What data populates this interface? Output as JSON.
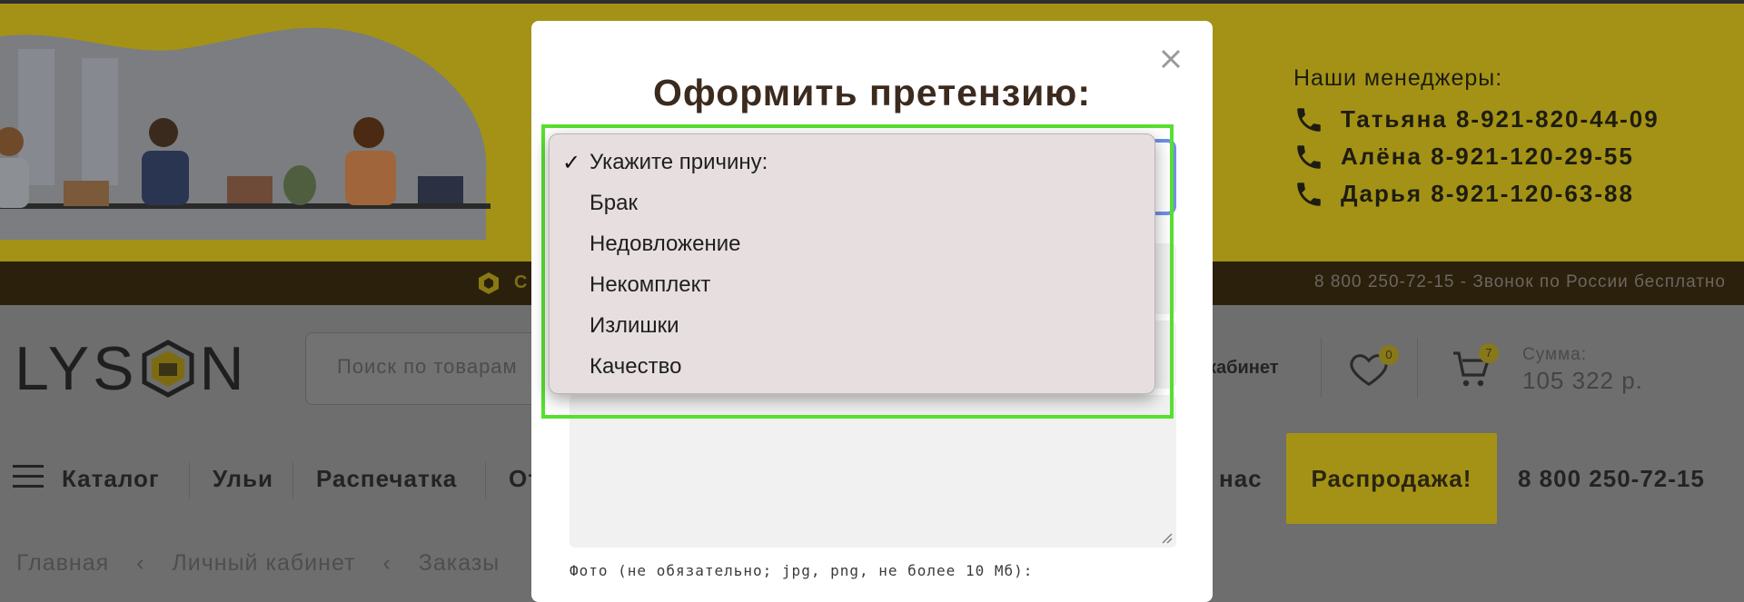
{
  "banner": {
    "managers_title": "Наши менеджеры:",
    "managers": [
      {
        "text": "Татьяна 8-921-820-44-09"
      },
      {
        "text": "Алёна 8-921-120-29-55"
      },
      {
        "text": "Дарья 8-921-120-63-88"
      }
    ]
  },
  "infobar": {
    "left_text": "С",
    "phone_text": "8 800 250-72-15 - Звонок по России бесплатно"
  },
  "header": {
    "logo_left": "LYS",
    "logo_right": "N",
    "search_placeholder": "Поиск по товарам",
    "account_label": "кабинет",
    "wishlist_count": "0",
    "cart_count": "7",
    "sum_label": "Сумма:",
    "sum_value": "105 322 р."
  },
  "nav": {
    "catalog": "Каталог",
    "items": [
      "Ульи",
      "Распечатка",
      "От"
    ],
    "about_fragment": "нас",
    "sale": "Распродажа!",
    "phone": "8 800 250-72-15"
  },
  "breadcrumbs": [
    "Главная",
    "Личный кабинет",
    "Заказы"
  ],
  "modal": {
    "title": "Оформить претензию:",
    "photo_label": "Фото (не обязательно; jpg, png, не более 10 Мб):"
  },
  "dropdown": {
    "selected": "Укажите причину:",
    "options": [
      "Укажите причину:",
      "Брак",
      "Недовложение",
      "Некомплект",
      "Излишки",
      "Качество"
    ]
  },
  "colors": {
    "accent_yellow": "#f5d820",
    "highlight_green": "#56e030",
    "focus_blue": "#6f8fe8",
    "dark_brown": "#3b2a1e"
  }
}
